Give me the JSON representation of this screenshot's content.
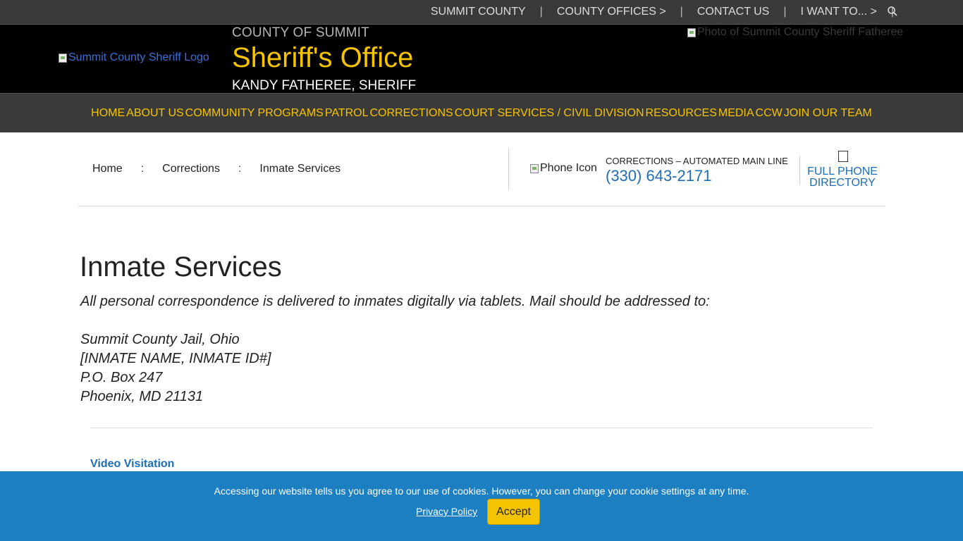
{
  "topbar": {
    "links": [
      "SUMMIT COUNTY",
      "COUNTY OFFICES >",
      "CONTACT US",
      "I WANT TO... >"
    ],
    "separator": "|",
    "search_icon": "search-icon"
  },
  "header": {
    "logo_alt": "Summit County Sheriff Logo",
    "county_label": "COUNTY OF SUMMIT",
    "office_title": "Sheriff's Office",
    "sheriff_name": "KANDY FATHEREE, SHERIFF",
    "photo_alt": "Photo of Summit County Sheriff Fatheree"
  },
  "nav": {
    "items": [
      "HOME",
      "ABOUT US",
      "COMMUNITY PROGRAMS",
      "PATROL",
      "CORRECTIONS",
      "COURT SERVICES / CIVIL DIVISION",
      "RESOURCES",
      "MEDIA",
      "CCW",
      "JOIN OUR TEAM"
    ]
  },
  "breadcrumb": {
    "items": [
      "Home",
      "Corrections",
      "Inmate Services"
    ],
    "separator": ":"
  },
  "contact": {
    "phone_icon_alt": "Phone Icon",
    "label": "CORRECTIONS – AUTOMATED MAIN LINE",
    "phone": "(330) 643-2171",
    "directory_line1": "FULL PHONE",
    "directory_line2": "DIRECTORY",
    "directory_icon": "document-icon"
  },
  "main": {
    "title": "Inmate Services",
    "intro": "All personal correspondence is delivered to inmates digitally via tablets. Mail should be addressed to:",
    "address": [
      "Summit County Jail, Ohio",
      "[INMATE NAME, INMATE ID#]",
      "P.O. Box 247",
      "Phoenix, MD 21131"
    ],
    "video_link": "Video Visitation"
  },
  "cookie": {
    "message": "Accessing our website tells us you agree to our use of cookies. However, you can change your cookie settings at any time.",
    "privacy_link": "Privacy Policy",
    "accept_label": "Accept"
  },
  "colors": {
    "accent_yellow": "#f5c400",
    "link_blue": "#1f6db3",
    "banner_blue": "#1b7fc2",
    "dark_bar": "#3a3a3a"
  }
}
